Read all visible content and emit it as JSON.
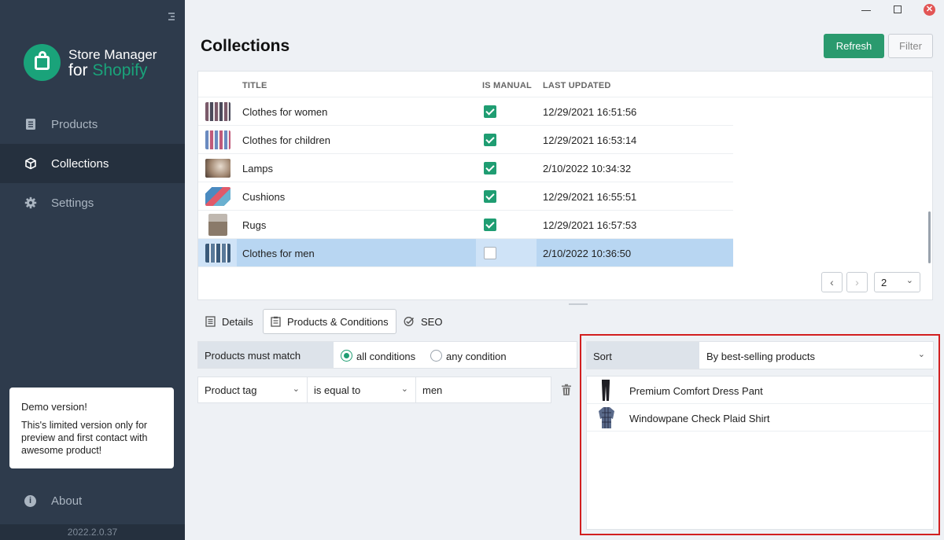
{
  "app": {
    "name_line1": "Store Manager",
    "name_line2_a": "for ",
    "name_line2_b": "Shopify",
    "version": "2022.2.0.37",
    "accent": "#1aa37a"
  },
  "sidebar": {
    "items": [
      {
        "label": "Products",
        "icon": "products-icon",
        "active": false
      },
      {
        "label": "Collections",
        "icon": "box-icon",
        "active": true
      },
      {
        "label": "Settings",
        "icon": "gear-icon",
        "active": false
      }
    ],
    "demo": {
      "title": "Demo version!",
      "text": "This's limited version only for preview and first contact with awesome product!"
    },
    "about_label": "About",
    "about_icon": "i"
  },
  "header": {
    "title": "Collections",
    "refresh_label": "Refresh",
    "filter_label": "Filter"
  },
  "table": {
    "columns": [
      "TITLE",
      "IS MANUAL",
      "LAST UPDATED"
    ],
    "rows": [
      {
        "title": "Clothes for women",
        "is_manual": true,
        "last_updated": "12/29/2021 16:51:56"
      },
      {
        "title": "Clothes for children",
        "is_manual": true,
        "last_updated": "12/29/2021 16:53:14"
      },
      {
        "title": "Lamps",
        "is_manual": true,
        "last_updated": "2/10/2022 10:34:32"
      },
      {
        "title": "Cushions",
        "is_manual": true,
        "last_updated": "12/29/2021 16:55:51"
      },
      {
        "title": "Rugs",
        "is_manual": true,
        "last_updated": "12/29/2021 16:57:53"
      },
      {
        "title": "Clothes for men",
        "is_manual": false,
        "last_updated": "2/10/2022 10:36:50",
        "selected": true
      }
    ],
    "pagination": {
      "prev": "‹",
      "next": "›",
      "page": "2"
    }
  },
  "tabs": [
    {
      "label": "Details",
      "icon": "document-icon",
      "active": false
    },
    {
      "label": "Products & Conditions",
      "icon": "clipboard-icon",
      "active": true
    },
    {
      "label": "SEO",
      "icon": "seo-check-icon",
      "active": false
    }
  ],
  "conditions": {
    "match_label": "Products must match",
    "options": [
      {
        "label": "all conditions",
        "selected": true
      },
      {
        "label": "any condition",
        "selected": false
      }
    ],
    "rule": {
      "field": "Product tag",
      "operator": "is equal to",
      "value": "men"
    }
  },
  "sort": {
    "label": "Sort",
    "value": "By best-selling products",
    "products": [
      {
        "name": "Premium Comfort Dress Pant"
      },
      {
        "name": "Windowpane Check Plaid Shirt"
      }
    ]
  },
  "chevron": "⌄"
}
